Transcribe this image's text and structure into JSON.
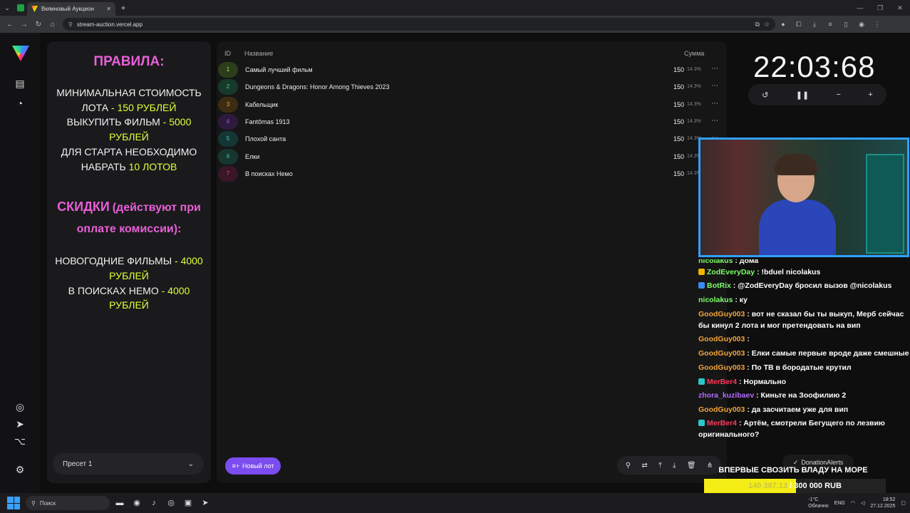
{
  "browser": {
    "tab_title": "Вкяиновый Аукцион",
    "url": "stream-auction.vercel.app"
  },
  "rules": {
    "heading": "ПРАВИЛА:",
    "l1": "МИНИМАЛЬНАЯ СТОИМОСТЬ ЛОТА",
    "l1v": "- 150 РУБЛЕЙ",
    "l2": "ВЫКУПИТЬ ФИЛЬМ",
    "l2v": "- 5000 РУБЛЕЙ",
    "l3": "ДЛЯ СТАРТА НЕОБХОДИМО НАБРАТЬ",
    "l3v": "10 ЛОТОВ",
    "discount_title": "СКИДКИ",
    "discount_note": "(действуют при оплате комиссии):",
    "d1": "НОВОГОДНИЕ ФИЛЬМЫ",
    "d1v": "- 4000 РУБЛЕЙ",
    "d2": "В ПОИСКАХ НЕМО",
    "d2v": "- 4000 РУБЛЕЙ"
  },
  "preset": {
    "label": "Пресет 1"
  },
  "lots": {
    "header_id": "ID",
    "header_name": "Название",
    "header_sum": "Сумма",
    "rows": [
      {
        "id": "1",
        "name": "Самый лучший фильм",
        "amount": "150",
        "percent": "14.3%",
        "color": "#2c3d1a",
        "text": "#b8e45a"
      },
      {
        "id": "2",
        "name": "Dungeons & Dragons: Honor Among Thieves 2023",
        "amount": "150",
        "percent": "14.3%",
        "color": "#173a2b",
        "text": "#47d68a"
      },
      {
        "id": "3",
        "name": "Кабельщик",
        "amount": "150",
        "percent": "14.3%",
        "color": "#3d2c12",
        "text": "#e3a13a"
      },
      {
        "id": "4",
        "name": "Fantômas 1913",
        "amount": "150",
        "percent": "14.3%",
        "color": "#2e1a3d",
        "text": "#a25be3"
      },
      {
        "id": "5",
        "name": "Плохой санта",
        "amount": "150",
        "percent": "14.3%",
        "color": "#143634",
        "text": "#3fcfc3"
      },
      {
        "id": "6",
        "name": "Елки",
        "amount": "150",
        "percent": "14.3%",
        "color": "#16362e",
        "text": "#3ccf9e"
      },
      {
        "id": "7",
        "name": "В поисках Немо",
        "amount": "150",
        "percent": "14.3%",
        "color": "#3a1626",
        "text": "#e34b86"
      }
    ],
    "new_lot": "Новый лот"
  },
  "timer": {
    "display": "22:03:68"
  },
  "chat": [
    {
      "user": "nicolakus",
      "text": ": дома",
      "color": "#7dff6a",
      "badge": ""
    },
    {
      "user": "ZodEveryDay",
      "text": ": !bduel nicolakus",
      "color": "#7dff6a",
      "badge": "#f0b400"
    },
    {
      "user": "BotRix",
      "text": ": @ZodEveryDay бросил вызов @nicolakus",
      "color": "#7dff6a",
      "badge": "#3a8bff"
    },
    {
      "user": "nicolakus",
      "text": ": ку",
      "color": "#7dff6a",
      "badge": ""
    },
    {
      "user": "GoodGuy003",
      "text": ": вот не сказал бы ты выкуп, Мерб сейчас бы кинул 2 лота и мог претендовать на вип",
      "color": "#f0a43a",
      "badge": ""
    },
    {
      "user": "GoodGuy003",
      "text": ":",
      "color": "#f0a43a",
      "badge": ""
    },
    {
      "user": "GoodGuy003",
      "text": ": Елки самые первые вроде даже смешные",
      "color": "#f0a43a",
      "badge": ""
    },
    {
      "user": "GoodGuy003",
      "text": ": По ТВ в бородатые крутил",
      "color": "#f0a43a",
      "badge": ""
    },
    {
      "user": "MerBer4",
      "text": ": Нормально",
      "color": "#ff3b5c",
      "badge": "#2ec7c7"
    },
    {
      "user": "zhora_kuzibaev",
      "text": ": Киньте на Зоофилию 2",
      "color": "#b46bff",
      "badge": ""
    },
    {
      "user": "GoodGuy003",
      "text": ": да засчитаем уже для вип",
      "color": "#f0a43a",
      "badge": ""
    },
    {
      "user": "MerBer4",
      "text": ": Артём, смотрели Бегущего по лезвию оригинального?",
      "color": "#ff3b5c",
      "badge": "#2ec7c7"
    }
  ],
  "donation": {
    "alerts_label": "DonationAlerts",
    "goal_title": "ВПЕРВЫЕ СВОЗИТЬ ВЛАДУ НА МОРЕ",
    "current": "140 387.13",
    "target": "/ 300 000 RUB",
    "progress": 0.468
  },
  "taskbar": {
    "search_placeholder": "Поиск",
    "weather_temp": "-1°C",
    "weather_desc": "Облачно",
    "lang": "ENG",
    "time": "18:52",
    "date": "27.12.2025"
  }
}
